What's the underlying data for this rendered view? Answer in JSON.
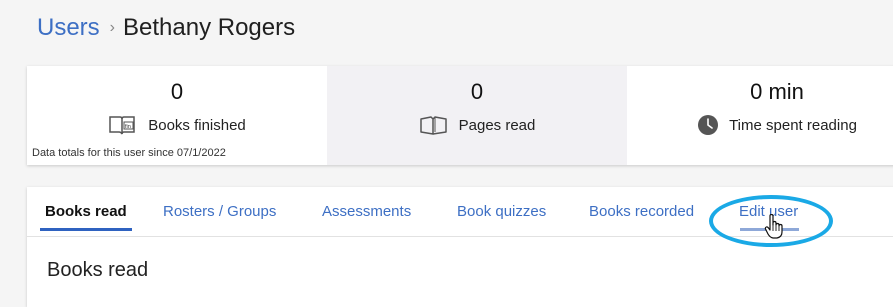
{
  "breadcrumb": {
    "parent": "Users",
    "separator": "›",
    "current": "Bethany Rogers"
  },
  "stats": [
    {
      "value": "0",
      "label": "Books finished",
      "icon": "book-icon"
    },
    {
      "value": "0",
      "label": "Pages read",
      "icon": "open-book-icon"
    },
    {
      "value": "0 min",
      "label": "Time spent reading",
      "icon": "clock-icon"
    }
  ],
  "stats_note": "Data totals for this user since 07/1/2022",
  "tabs": [
    {
      "label": "Books read",
      "active": true
    },
    {
      "label": "Rosters / Groups"
    },
    {
      "label": "Assessments"
    },
    {
      "label": "Book quizzes"
    },
    {
      "label": "Books recorded"
    },
    {
      "label": "Edit user",
      "hovered": true
    }
  ],
  "section": {
    "title": "Books read"
  },
  "colors": {
    "link": "#3d6fc4",
    "active_tab_underline": "#2f62c0",
    "highlight_ring": "#1aa9e6"
  }
}
